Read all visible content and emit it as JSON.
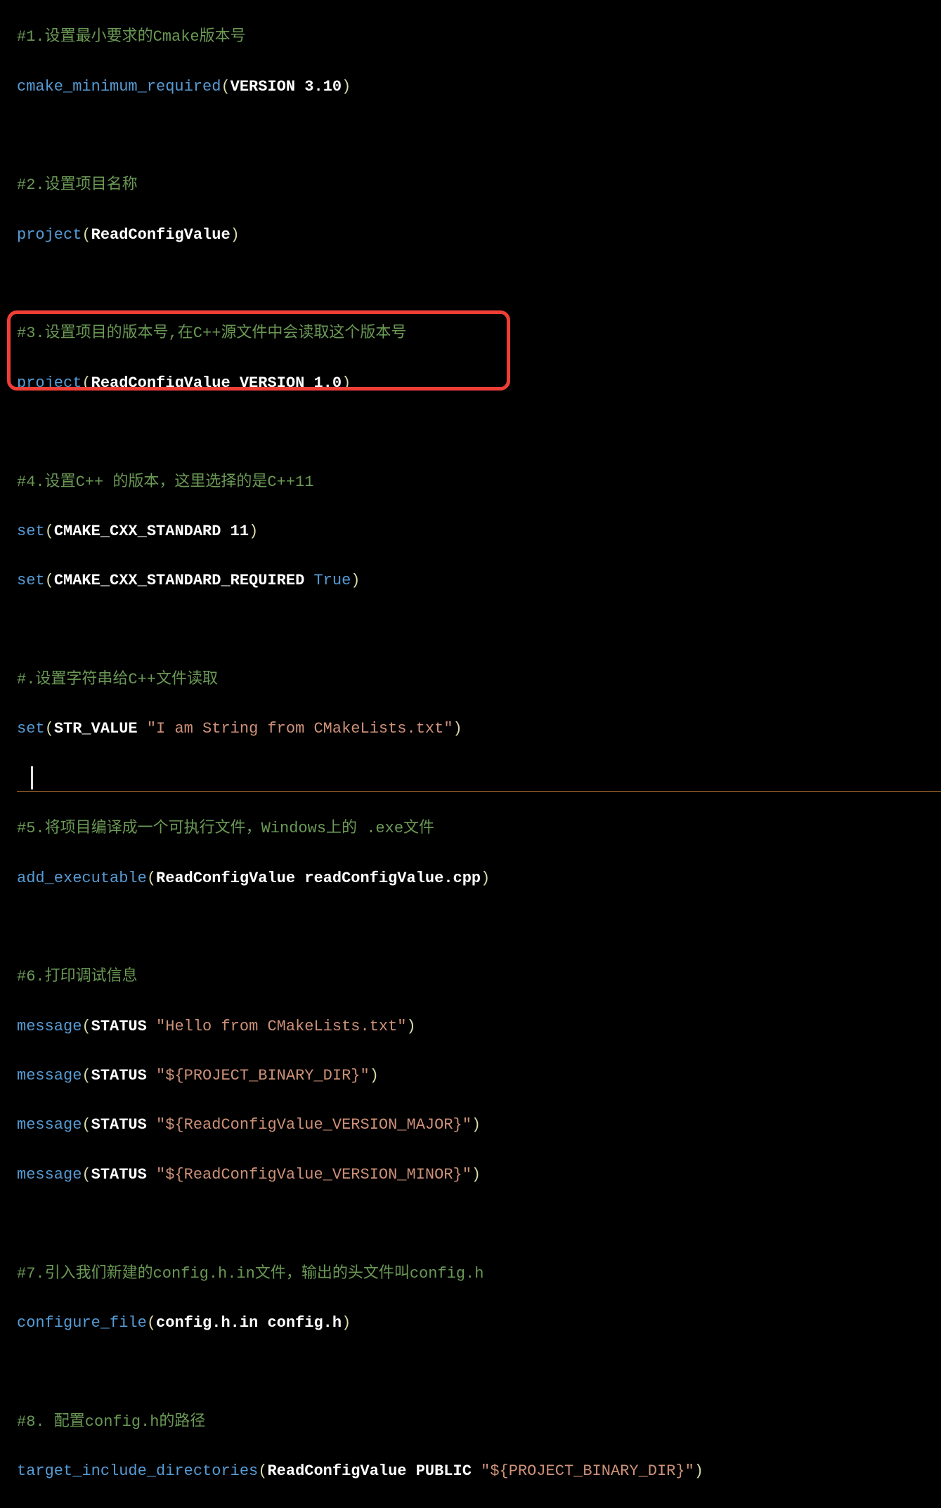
{
  "lines": {
    "c1": "#1.设置最小要求的Cmake版本号",
    "l1_func": "cmake_minimum_required",
    "l1_args": "VERSION 3.10",
    "c2": "#2.设置项目名称",
    "l2_func": "project",
    "l2_args": "ReadConfigValue",
    "c3": "#3.设置项目的版本号,在C++源文件中会读取这个版本号",
    "l3_func": "project",
    "l3_args": "ReadConfigValue VERSION 1.0",
    "c4": "#4.设置C++ 的版本，这里选择的是C++11",
    "l4a_func": "set",
    "l4a_args": "CMAKE_CXX_STANDARD 11",
    "l4b_func": "set",
    "l4b_arg1": "CMAKE_CXX_STANDARD_REQUIRED ",
    "l4b_arg2": "True",
    "c5": "#.设置字符串给C++文件读取",
    "l5_func": "set",
    "l5_arg1": "STR_VALUE ",
    "l5_str": "\"I am String from CMakeLists.txt\"",
    "c6": "#5.将项目编译成一个可执行文件，Windows上的 .exe文件",
    "l6_func": "add_executable",
    "l6_args": "ReadConfigValue readConfigValue.cpp",
    "c7": "#6.打印调试信息",
    "l7a_func": "message",
    "l7a_arg1": "STATUS ",
    "l7a_str": "\"Hello from CMakeLists.txt\"",
    "l7b_func": "message",
    "l7b_arg1": "STATUS ",
    "l7b_str": "\"${PROJECT_BINARY_DIR}\"",
    "l7c_func": "message",
    "l7c_arg1": "STATUS ",
    "l7c_str": "\"${ReadConfigValue_VERSION_MAJOR}\"",
    "l7d_func": "message",
    "l7d_arg1": "STATUS ",
    "l7d_str": "\"${ReadConfigValue_VERSION_MINOR}\"",
    "c8": "#7.引入我们新建的config.h.in文件，输出的头文件叫config.h",
    "l8_func": "configure_file",
    "l8_args": "config.h.in config.h",
    "c9": "#8. 配置config.h的路径",
    "l9_func": "target_include_directories",
    "l9_arg1": "ReadConfigValue PUBLIC ",
    "l9_str": "\"${PROJECT_BINARY_DIR}\""
  }
}
